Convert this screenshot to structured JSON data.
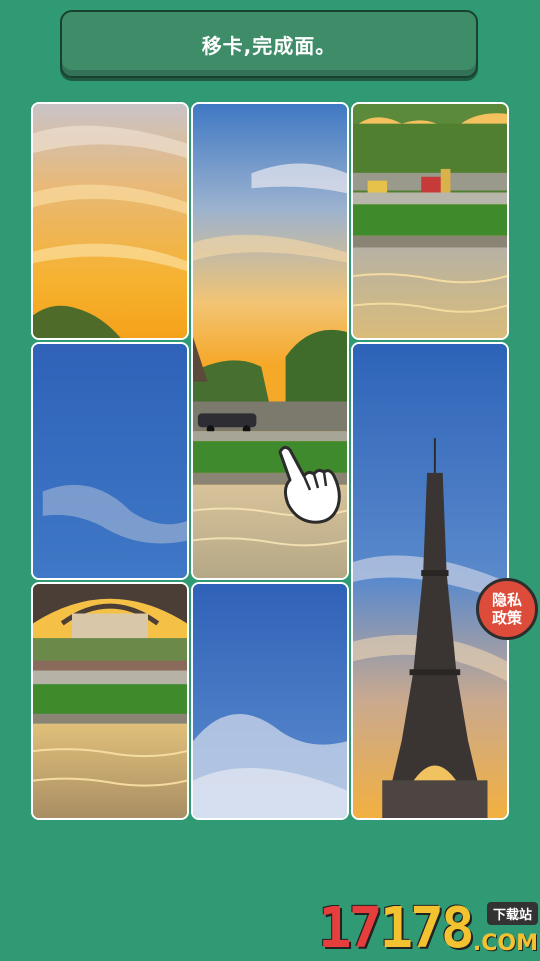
{
  "banner": {
    "text": "移卡,完成面。"
  },
  "tiles": [
    {
      "id": "tile-1",
      "scene": "sunset-sky"
    },
    {
      "id": "tile-2",
      "scene": "sky-street-pond"
    },
    {
      "id": "tile-3",
      "scene": "trees-pond"
    },
    {
      "id": "tile-4",
      "scene": "blue-sky"
    },
    {
      "id": "tile-5",
      "scene": "eiffel-tower"
    },
    {
      "id": "tile-6",
      "scene": "trocadero-pond"
    },
    {
      "id": "tile-7",
      "scene": "blue-sky-clouds"
    }
  ],
  "hint": {
    "icon": "pointing-hand-icon"
  },
  "privacy": {
    "line1": "隐私",
    "line2": "政策"
  },
  "watermark": {
    "digits_a": "17",
    "digits_b": "178",
    "badge": "下载站",
    "suffix": ".COM"
  },
  "colors": {
    "background": "#2f9a74",
    "banner": "#3f8c69",
    "privacy": "#dd4b3a"
  }
}
